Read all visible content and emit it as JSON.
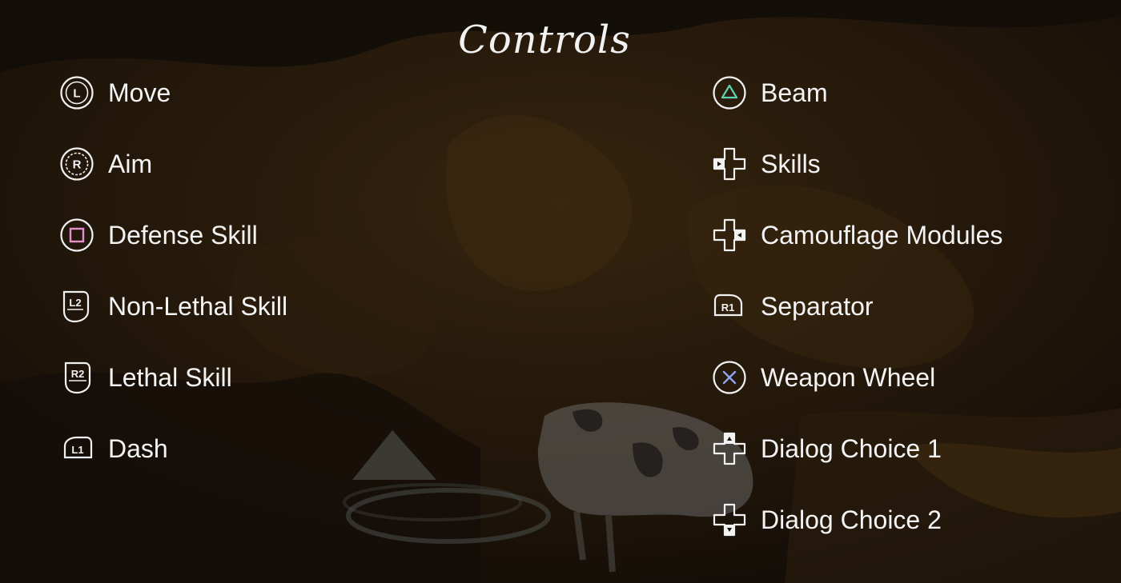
{
  "screen": {
    "title": "Controls"
  },
  "controls_left": [
    {
      "label": "Move",
      "icon": "l-stick-icon"
    },
    {
      "label": "Aim",
      "icon": "r-stick-icon"
    },
    {
      "label": "Defense Skill",
      "icon": "square-button-icon"
    },
    {
      "label": "Non-Lethal Skill",
      "icon": "l2-trigger-icon"
    },
    {
      "label": "Lethal Skill",
      "icon": "r2-trigger-icon"
    },
    {
      "label": "Dash",
      "icon": "l1-bumper-icon"
    }
  ],
  "controls_right": [
    {
      "label": "Beam",
      "icon": "triangle-button-icon"
    },
    {
      "label": "Skills",
      "icon": "dpad-left-icon"
    },
    {
      "label": "Camouflage Modules",
      "icon": "dpad-right-icon"
    },
    {
      "label": "Separator",
      "icon": "r1-bumper-icon"
    },
    {
      "label": "Weapon Wheel",
      "icon": "cross-button-icon"
    },
    {
      "label": "Dialog Choice 1",
      "icon": "dpad-up-icon"
    },
    {
      "label": "Dialog Choice 2",
      "icon": "dpad-down-icon"
    }
  ],
  "icon_glyphs": {
    "l_stick": "L",
    "r_stick": "R",
    "l2": "L2",
    "r2": "R2",
    "l1": "L1",
    "r1": "R1"
  },
  "colors": {
    "text": "#f4f4f4",
    "triangle": "#5fd3b0",
    "square": "#e58fcf",
    "cross": "#8fa6ef",
    "overlay": "#1b130b"
  }
}
